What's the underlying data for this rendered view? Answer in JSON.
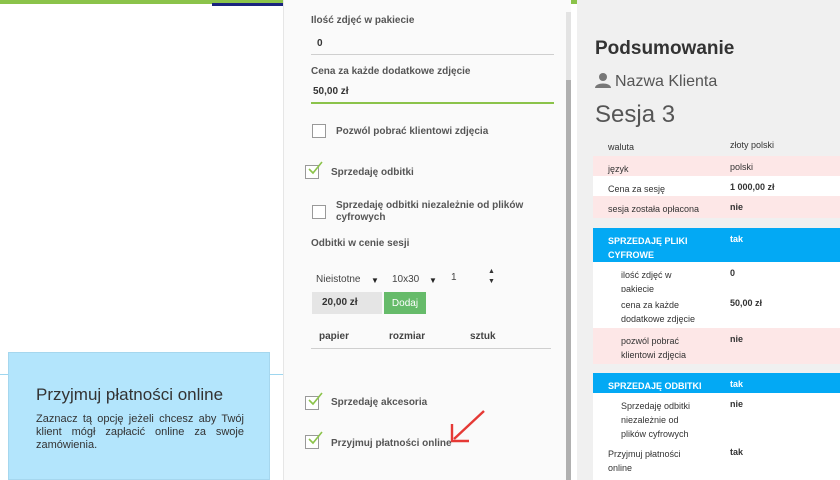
{
  "tip": {
    "title": "Przyjmuj płatności online",
    "text": "Zaznacz tą opcję jeżeli chcesz aby Twój klient mógł zapłacić online za swoje zamówienia."
  },
  "form": {
    "photos_label": "Ilość zdjęć w pakiecie",
    "photos_value": "0",
    "extra_price_label": "Cena za każde dodatkowe zdjęcie",
    "extra_price_value": "50,00 zł",
    "allow_download_label": "Pozwól pobrać klientowi zdjęcia",
    "allow_download_checked": false,
    "sell_prints_label": "Sprzedaję odbitki",
    "sell_prints_checked": true,
    "sell_prints_independent_label": "Sprzedaję odbitki niezależnie od plików cyfrowych",
    "sell_prints_independent_checked": false,
    "prints_in_price_label": "Odbitki w cenie sesji",
    "paper_select": "Nieistotne",
    "size_select": "10x30",
    "quantity_value": "1",
    "price_value": "20,00 zł",
    "add_button": "Dodaj",
    "table_headers": [
      "papier",
      "rozmiar",
      "sztuk"
    ],
    "sell_accessories_label": "Sprzedaję akcesoria",
    "sell_accessories_checked": true,
    "online_payments_label": "Przyjmuj płatności online",
    "online_payments_checked": true
  },
  "summary": {
    "title": "Podsumowanie",
    "client": "Nazwa Klienta",
    "session": "Sesja 3",
    "rows": [
      {
        "key": "waluta",
        "value": "złoty polski"
      },
      {
        "key": "język",
        "value": "polski"
      },
      {
        "key": "Cena za sesję",
        "value": "1 000,00 zł"
      },
      {
        "key": "sesja została opłacona",
        "value": "nie"
      },
      {
        "key": "SPRZEDAJĘ PLIKI CYFROWE",
        "value": "tak"
      },
      {
        "key": "ilość zdjęć w pakiecie",
        "value": "0"
      },
      {
        "key": "cena za każde dodatkowe zdjęcie",
        "value": "50,00 zł"
      },
      {
        "key": "pozwól pobrać klientowi zdjęcia",
        "value": "nie"
      },
      {
        "key": "SPRZEDAJĘ ODBITKI",
        "value": "tak"
      },
      {
        "key": "Sprzedaję odbitki niezależnie od plików cyfrowych",
        "value": "nie"
      },
      {
        "key": "Przyjmuj płatności online",
        "value": "tak"
      }
    ]
  },
  "colors": {
    "accent_green": "#8bc34a",
    "button_green": "#66bb6a",
    "header_blue": "#03a9f4",
    "tip_blue": "#b3e5fc",
    "row_pink": "#fde7e7",
    "arrow_red": "#e53935"
  }
}
